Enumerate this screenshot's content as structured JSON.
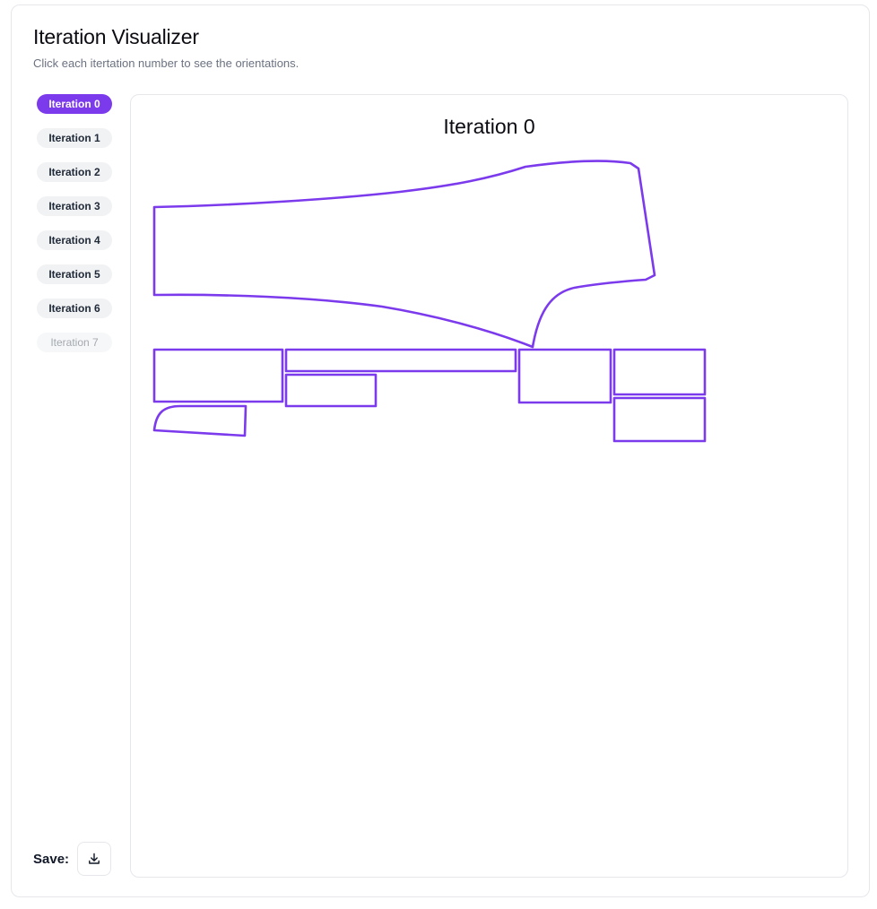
{
  "header": {
    "title": "Iteration Visualizer",
    "subtitle": "Click each itertation number to see the orientations."
  },
  "iterations": [
    {
      "label": "Iteration 0",
      "state": "active"
    },
    {
      "label": "Iteration 1",
      "state": "normal"
    },
    {
      "label": "Iteration 2",
      "state": "normal"
    },
    {
      "label": "Iteration 3",
      "state": "normal"
    },
    {
      "label": "Iteration 4",
      "state": "normal"
    },
    {
      "label": "Iteration 5",
      "state": "normal"
    },
    {
      "label": "Iteration 6",
      "state": "normal"
    },
    {
      "label": "Iteration 7",
      "state": "faded"
    }
  ],
  "save": {
    "label": "Save:",
    "icon": "download-icon"
  },
  "viewer": {
    "title": "Iteration 0",
    "stroke_color": "#7c3aed"
  },
  "colors": {
    "accent": "#7c3aed",
    "pill_bg": "#f1f2f4",
    "border": "#e5e7eb"
  }
}
